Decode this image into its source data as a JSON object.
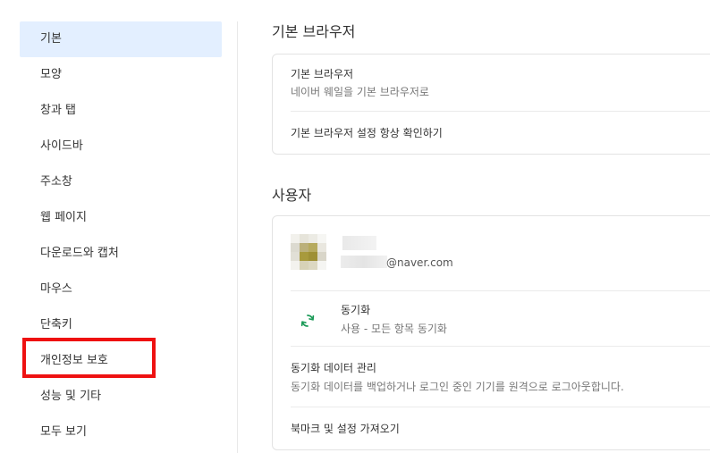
{
  "sidebar": {
    "items": [
      {
        "label": "기본",
        "active": true
      },
      {
        "label": "모양"
      },
      {
        "label": "창과 탭"
      },
      {
        "label": "사이드바"
      },
      {
        "label": "주소창"
      },
      {
        "label": "웹 페이지"
      },
      {
        "label": "다운로드와 캡처"
      },
      {
        "label": "마우스"
      },
      {
        "label": "단축키"
      },
      {
        "label": "개인정보 보호",
        "highlighted": true
      },
      {
        "label": "성능 및 기타"
      },
      {
        "label": "모두 보기"
      }
    ]
  },
  "colors": {
    "active_bg": "#e3efff",
    "highlight_border": "#ee1111",
    "sync_icon": "#1a9a57"
  },
  "default_browser": {
    "section_title": "기본 브라우저",
    "row1_title": "기본 브라우저",
    "row1_sub": "네이버 웨일을 기본 브라우저로",
    "row2_title": "기본 브라우저 설정 항상 확인하기"
  },
  "user": {
    "section_title": "사용자",
    "email_domain": "@naver.com",
    "sync": {
      "title": "동기화",
      "sub": "사용 - 모든 항목 동기화",
      "icon": "sync-icon"
    },
    "sync_data": {
      "title": "동기화 데이터 관리",
      "sub": "동기화 데이터를 백업하거나 로그인 중인 기기를 원격으로 로그아웃합니다."
    },
    "import_label": "북마크 및 설정 가져오기"
  }
}
